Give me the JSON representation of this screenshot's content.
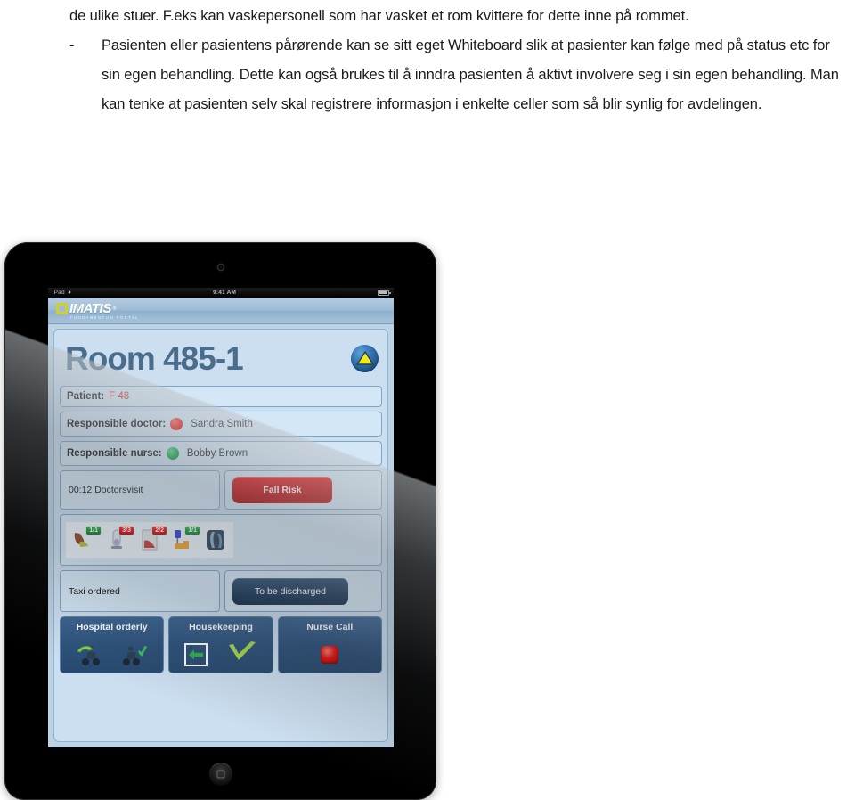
{
  "document": {
    "paragraph_1": "de ulike stuer. F.eks kan vaskepersonell som har vasket et rom kvittere for dette inne på rommet.",
    "bullet_marker": "-",
    "paragraph_2": "Pasienten eller pasientens pårørende kan se sitt eget Whiteboard slik at pasienter kan følge med på status etc for sin egen behandling. Dette kan også brukes til å inndra pasienten å aktivt involvere seg i sin egen behandling. Man kan tenke at pasienten selv skal registrere informasjon i enkelte celler som så blir synlig for avdelingen."
  },
  "tablet": {
    "status_bar": {
      "carrier": "iPad",
      "wifi_icon": "wifi-icon",
      "time": "9:41 AM",
      "battery_icon": "battery-icon"
    },
    "app_header": {
      "logo_mark": "imatis-logo-mark",
      "logo_word": "IMATIS",
      "logo_registered": "®",
      "logo_subtitle": "FUNDAMENTUM PORTAL"
    },
    "screen": {
      "room_title": "Room 485-1",
      "status_badge_icon": "triangle-up-icon",
      "rows": [
        {
          "label": "Patient:",
          "value": "F 48",
          "value_color": "#d81d1d"
        },
        {
          "label": "Responsible doctor:",
          "value": "Sandra Smith",
          "dot": "red"
        },
        {
          "label": "Responsible nurse:",
          "value": "Bobby Brown",
          "dot": "green"
        }
      ],
      "doctorsvisit": "00:12 Doctorsvisit",
      "fall_risk_button": "Fall Risk",
      "med_icons": [
        {
          "icon": "liver-organ-icon",
          "badge": "1/1",
          "badge_color": "green"
        },
        {
          "icon": "test-tube-icon",
          "badge": "3/3",
          "badge_color": "red"
        },
        {
          "icon": "blood-chart-icon",
          "badge": "2/2",
          "badge_color": "red"
        },
        {
          "icon": "iv-drip-icon",
          "badge": "1/1",
          "badge_color": "green"
        },
        {
          "icon": "xray-image-icon",
          "badge": "",
          "badge_color": ""
        }
      ],
      "taxi_ordered": "Taxi ordered",
      "to_be_discharged_button": "To be discharged",
      "actions": [
        {
          "title": "Hospital orderly",
          "icons": [
            "porter-arrow-icon",
            "porter-check-icon"
          ]
        },
        {
          "title": "Housekeeping",
          "icons": [
            "green-left-arrow-icon",
            "green-check-icon"
          ]
        },
        {
          "title": "Nurse Call",
          "icons": [
            "nurse-call-red-button-icon"
          ]
        }
      ]
    }
  },
  "colors": {
    "accent_blue": "#4a6d8c",
    "panel_blue": "#d4e7f6",
    "navy_button": "#1d3a5a",
    "red_alert": "#c20000",
    "green_ok": "#0d7a2c"
  }
}
